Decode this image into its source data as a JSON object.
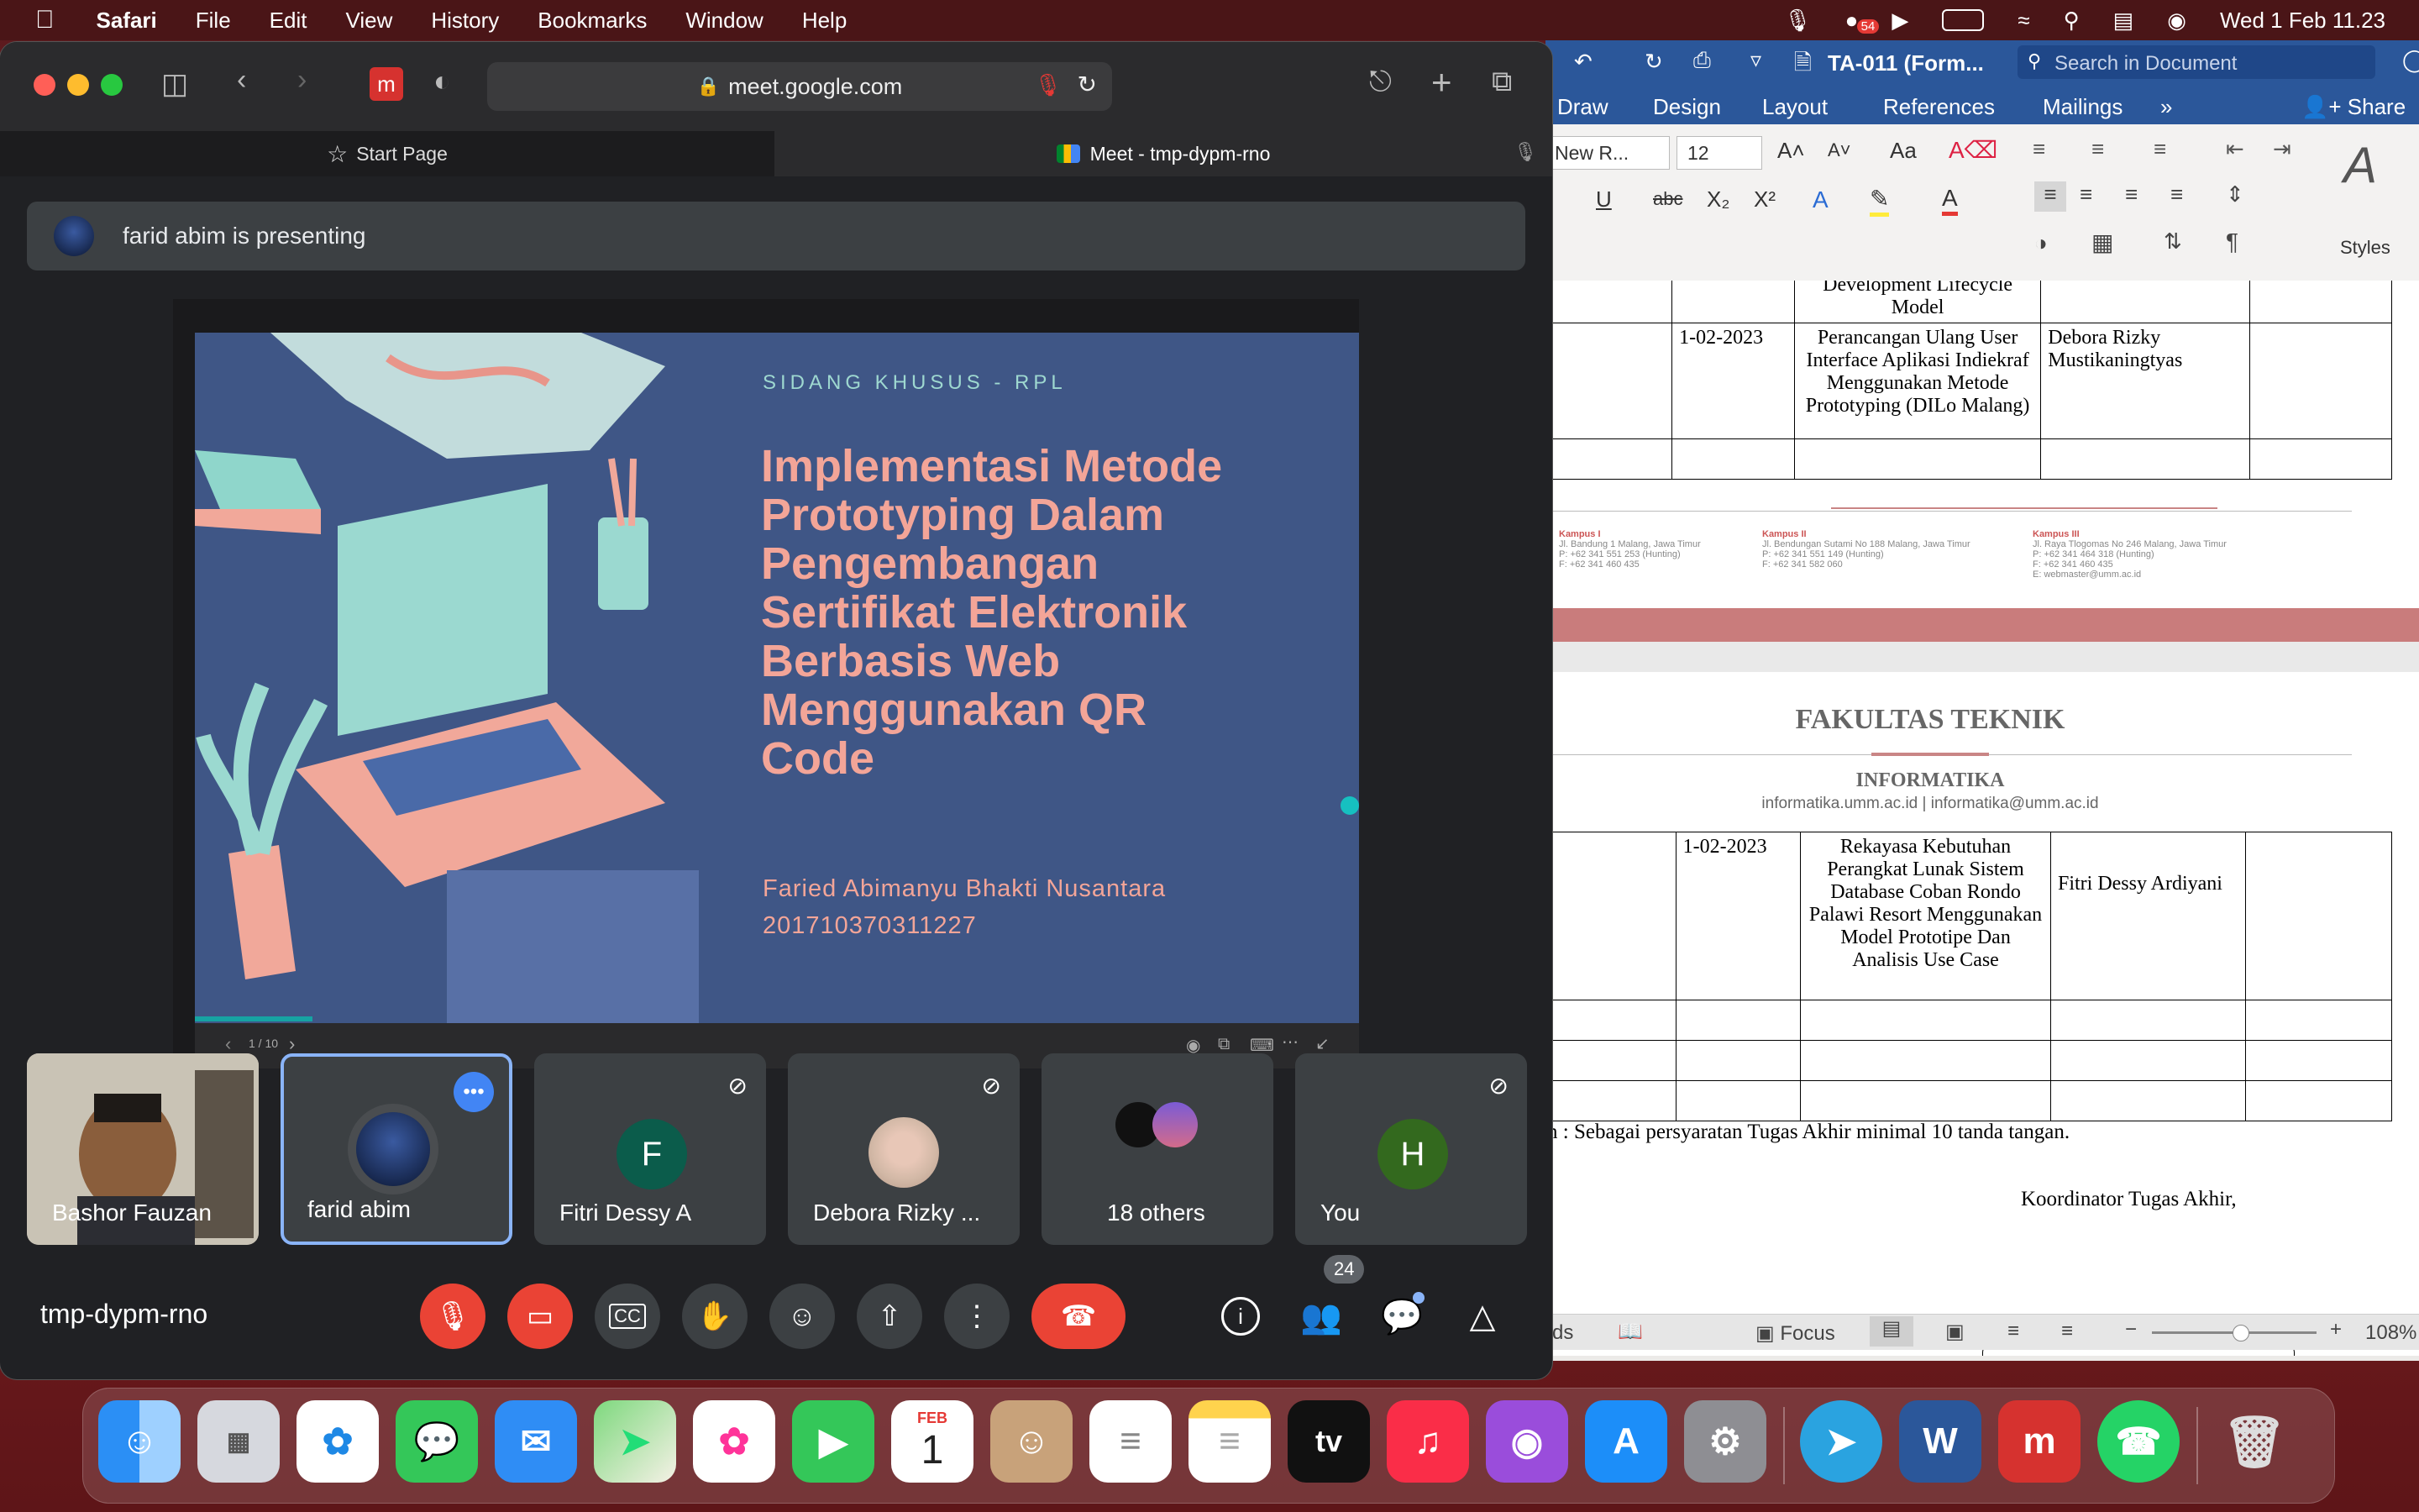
{
  "menubar": {
    "app_name": "Safari",
    "items": [
      "File",
      "Edit",
      "View",
      "History",
      "Bookmarks",
      "Window",
      "Help"
    ],
    "battery_badge": "54",
    "datetime": "Wed 1 Feb  11.23"
  },
  "safari": {
    "url": "meet.google.com",
    "tabs": [
      {
        "label": "Start Page"
      },
      {
        "label": "Meet - tmp-dypm-rno"
      }
    ]
  },
  "meet": {
    "presenting_text": "farid abim is presenting",
    "slide": {
      "eyebrow": "SIDANG KHUSUS - RPL",
      "title_lines": [
        "Implementasi Metode",
        "Prototyping Dalam",
        "Pengembangan",
        "Sertifikat Elektronik",
        "Berbasis Web",
        "Menggunakan QR",
        "Code"
      ],
      "author": "Faried Abimanyu Bhakti Nusantara",
      "nim": "201710370311227",
      "page_indicator": "1 / 10"
    },
    "participants": [
      {
        "name": "Bashor Fauzan"
      },
      {
        "name": "farid abim"
      },
      {
        "name": "Fitri Dessy A",
        "initial": "F",
        "color": "#0b5c4b"
      },
      {
        "name": "Debora Rizky ..."
      },
      {
        "name": "18 others"
      },
      {
        "name": "You",
        "initial": "H",
        "color": "#33691e"
      }
    ],
    "meeting_code": "tmp-dypm-rno",
    "people_count": "24"
  },
  "word": {
    "title": "TA-011 (Form...",
    "search_placeholder": "Search in Document",
    "ribbon_tabs": [
      "Draw",
      "Design",
      "Layout",
      "References",
      "Mailings"
    ],
    "share_label": "Share",
    "font_name": "New R...",
    "font_size": "12",
    "styles_label": "Styles",
    "top_table": {
      "row0_title": "Development Lifecycle Model",
      "row1_date": "1-02-2023",
      "row1_title": "Perancangan Ulang User Interface Aplikasi Indiekraf Menggunakan Metode Prototyping (DILo Malang)",
      "row1_name": "Debora Rizky Mustikaningtyas"
    },
    "footer_campus": [
      {
        "name": "Kampus I",
        "lines": [
          "Jl. Bandung 1 Malang, Jawa Timur",
          "P: +62 341 551 253 (Hunting)",
          "F: +62 341 460 435"
        ]
      },
      {
        "name": "Kampus II",
        "lines": [
          "Jl. Bendungan Sutami No 188 Malang, Jawa Timur",
          "P: +62 341 551 149 (Hunting)",
          "F: +62 341 582 060"
        ]
      },
      {
        "name": "Kampus III",
        "lines": [
          "Jl. Raya Tlogomas No 246 Malang, Jawa Timur",
          "P: +62 341 464 318 (Hunting)",
          "F: +62 341 460 435",
          "E: webmaster@umm.ac.id"
        ]
      }
    ],
    "faculty": "FAKULTAS TEKNIK",
    "dept": "INFORMATIKA",
    "dept_contact": "informatika.umm.ac.id | informatika@umm.ac.id",
    "bottom_table": {
      "row_date": "1-02-2023",
      "row_title": "Rekayasa Kebutuhan Perangkat Lunak Sistem Database Coban Rondo Palawi Resort Menggunakan Model Prototipe Dan Analisis Use Case",
      "row_name": "Fitri Dessy Ardiyani"
    },
    "note": "n : Sebagai persyaratan Tugas Akhir minimal 10 tanda tangan.",
    "signature": "Koordinator Tugas Akhir,",
    "status_words": "rds",
    "status_focus": "Focus",
    "zoom": "108%"
  },
  "dock": {
    "calendar_month": "FEB",
    "calendar_day": "1",
    "tv_label": "tv"
  }
}
